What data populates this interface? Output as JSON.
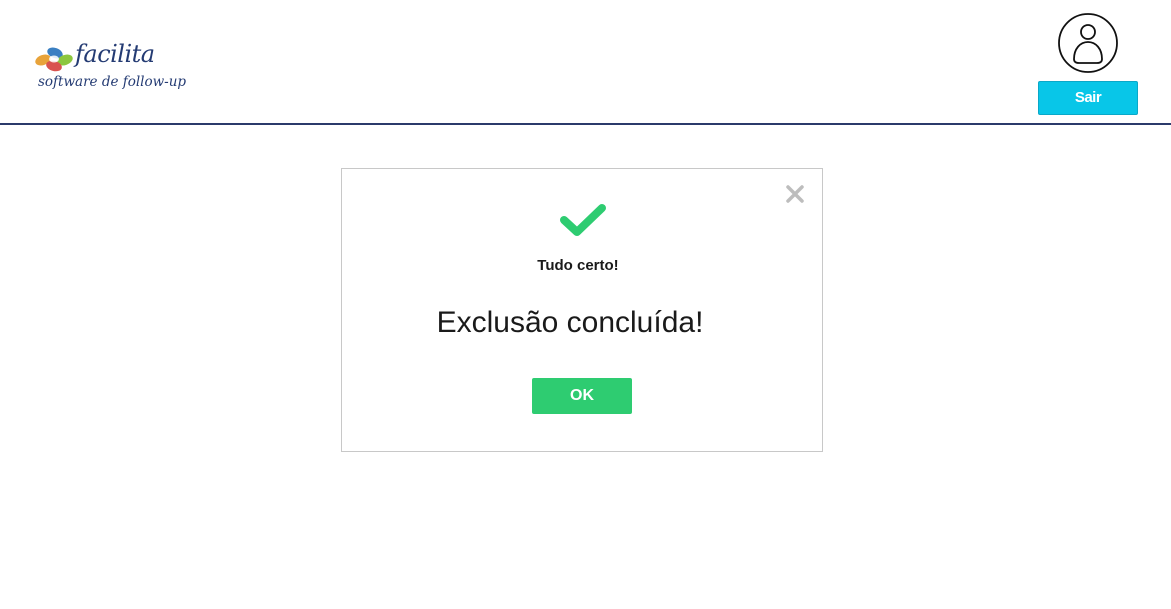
{
  "header": {
    "logo": {
      "name": "facilita",
      "tagline": "software de follow-up"
    },
    "logout_label": "Sair",
    "avatar_icon": "user-icon",
    "accent_color": "#08c6e8",
    "border_color": "#2b3a6b"
  },
  "modal": {
    "status_icon": "check-icon",
    "status_color": "#2ecc71",
    "subtitle": "Tudo certo!",
    "message": "Exclusão concluída!",
    "ok_label": "OK",
    "close_icon": "close-icon"
  }
}
